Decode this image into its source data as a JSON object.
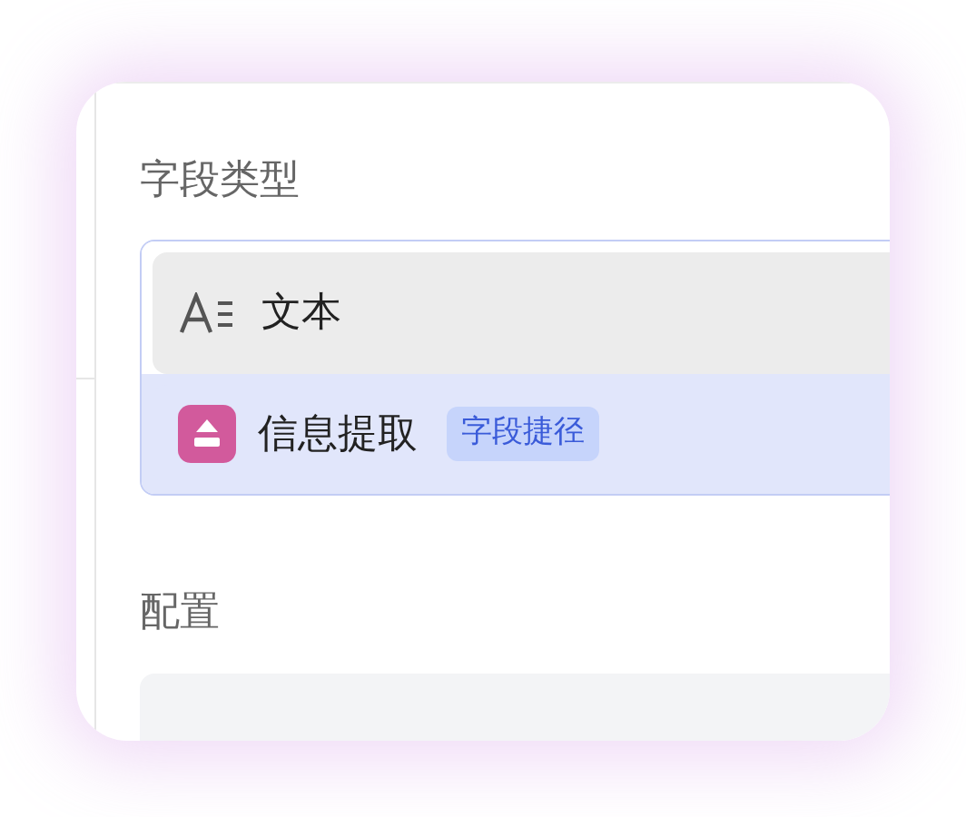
{
  "field_type": {
    "label": "字段类型",
    "options": [
      {
        "kind": "text",
        "label": "文本",
        "selected": true
      },
      {
        "kind": "extract",
        "label": "信息提取",
        "selected": false,
        "tag": "字段捷径"
      }
    ]
  },
  "config": {
    "label": "配置"
  }
}
